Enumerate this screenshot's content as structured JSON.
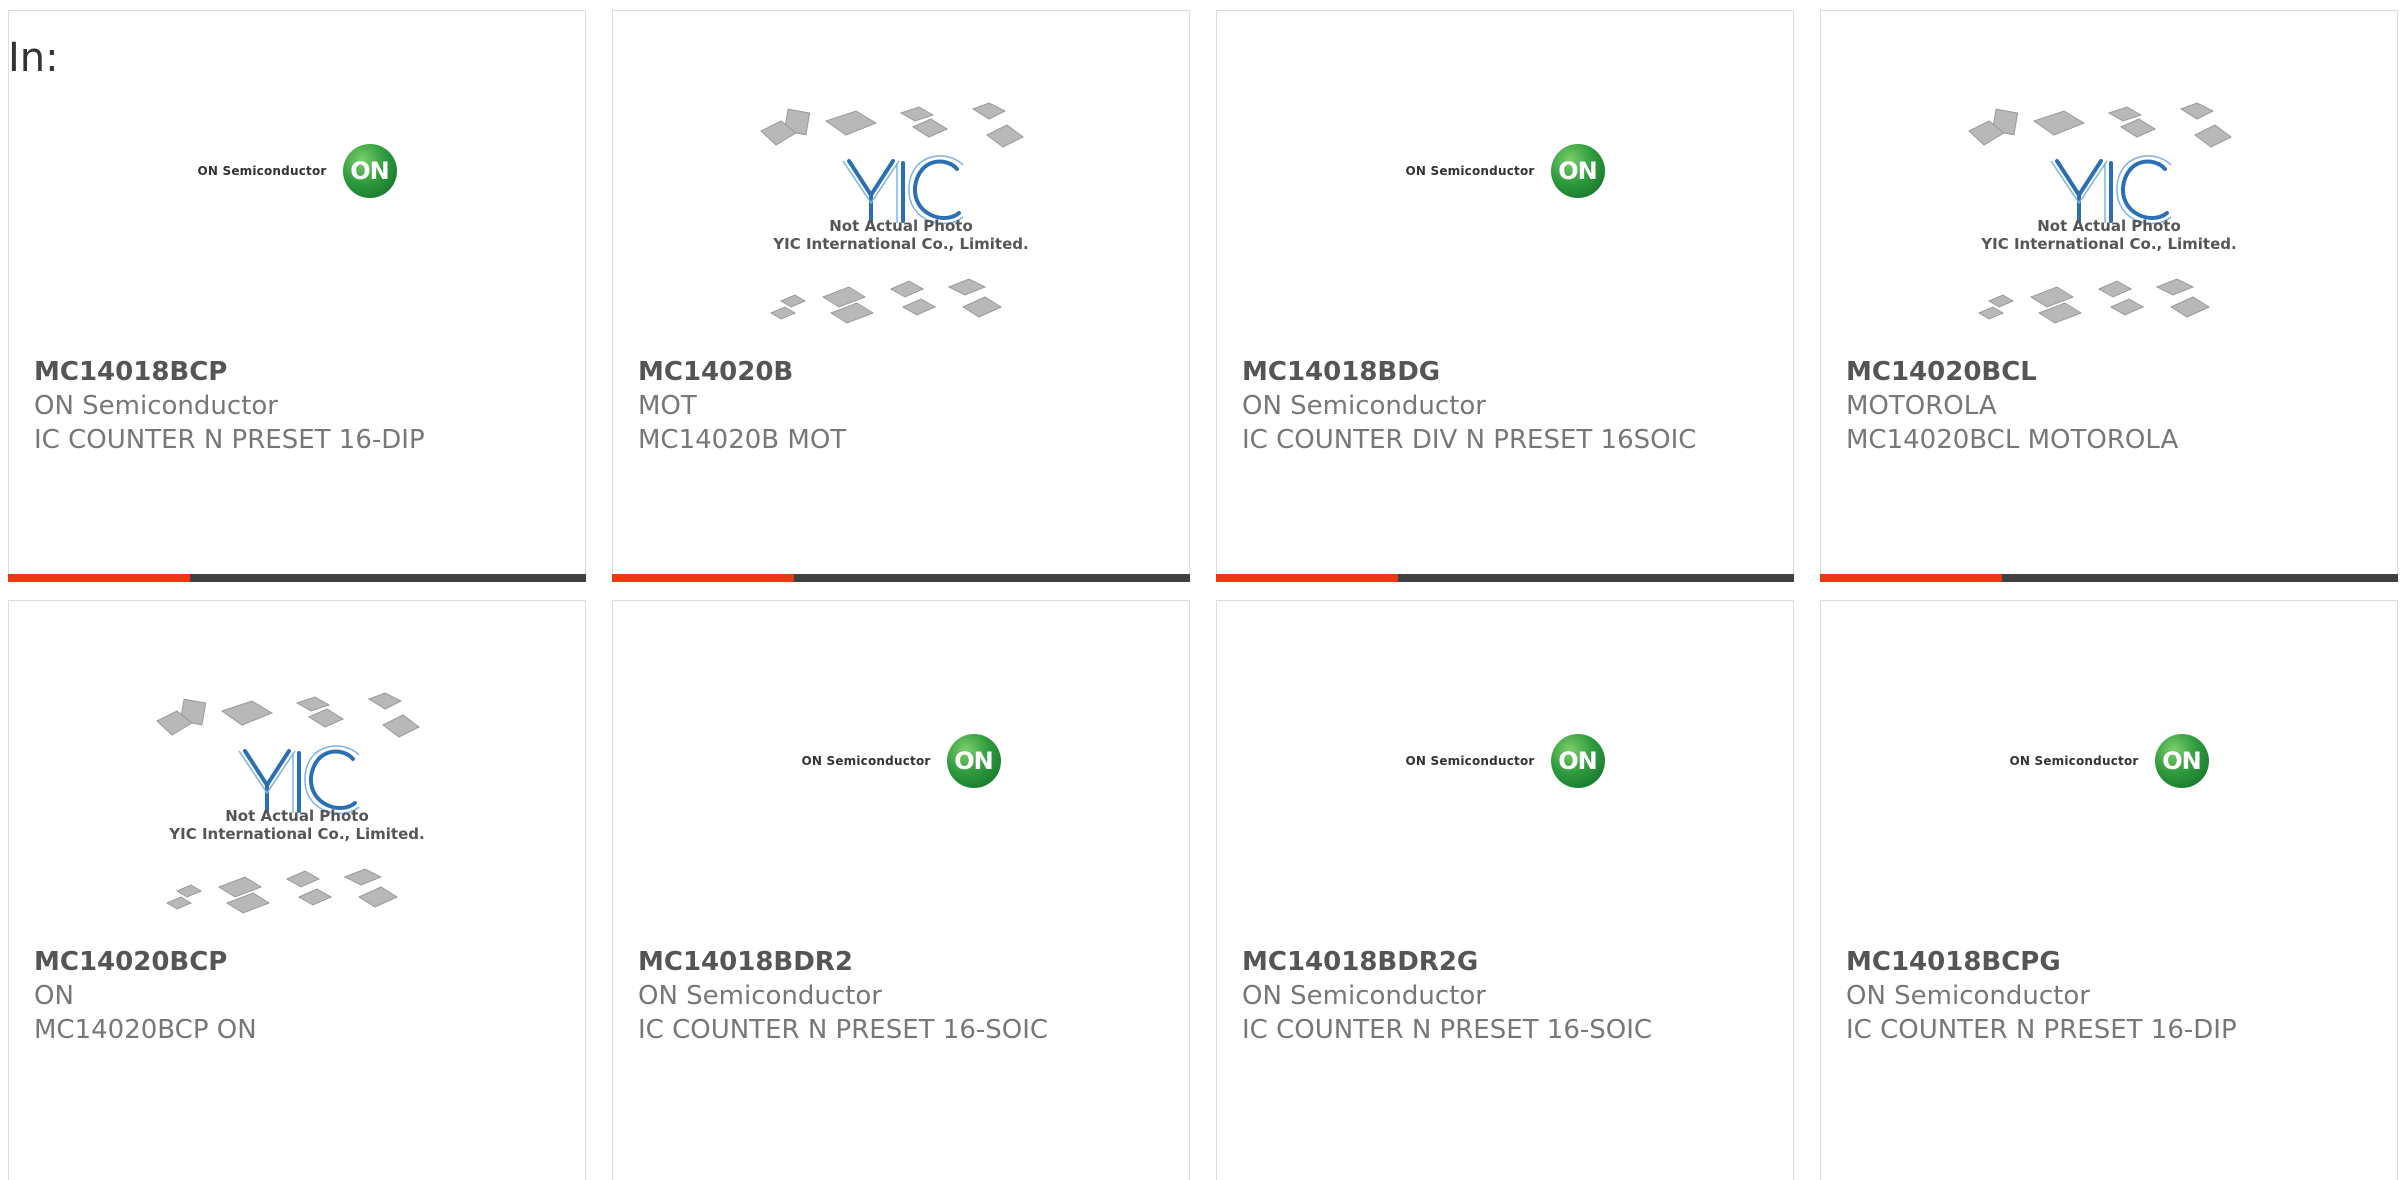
{
  "header": {
    "filter_label": "In:"
  },
  "colors": {
    "accent": "#e63a12",
    "bar": "#404040",
    "on_green": "#2e9a3e",
    "yic_blue": "#2a6fb5"
  },
  "products": [
    {
      "part": "MC14018BCP",
      "manufacturer": "ON Semiconductor",
      "description": "IC COUNTER N PRESET 16-DIP",
      "image": "on-semiconductor-logo"
    },
    {
      "part": "MC14020B",
      "manufacturer": "MOT",
      "description": "MC14020B MOT",
      "image": "yic-not-actual-photo"
    },
    {
      "part": "MC14018BDG",
      "manufacturer": "ON Semiconductor",
      "description": "IC COUNTER DIV N PRESET 16SOIC",
      "image": "on-semiconductor-logo"
    },
    {
      "part": "MC14020BCL",
      "manufacturer": "MOTOROLA",
      "description": "MC14020BCL MOTOROLA",
      "image": "yic-not-actual-photo"
    },
    {
      "part": "MC14020BCP",
      "manufacturer": "ON",
      "description": "MC14020BCP ON",
      "image": "yic-not-actual-photo"
    },
    {
      "part": "MC14018BDR2",
      "manufacturer": "ON Semiconductor",
      "description": "IC COUNTER N PRESET 16-SOIC",
      "image": "on-semiconductor-logo"
    },
    {
      "part": "MC14018BDR2G",
      "manufacturer": "ON Semiconductor",
      "description": "IC COUNTER N PRESET 16-SOIC",
      "image": "on-semiconductor-logo"
    },
    {
      "part": "MC14018BCPG",
      "manufacturer": "ON Semiconductor",
      "description": "IC COUNTER N PRESET 16-DIP",
      "image": "on-semiconductor-logo"
    }
  ],
  "logos": {
    "on": {
      "wordmark": "ON Semiconductor",
      "badge": "ON"
    },
    "yic": {
      "mark": "YIC",
      "caption_line1": "Not Actual Photo",
      "caption_line2": "YIC International Co., Limited."
    }
  }
}
